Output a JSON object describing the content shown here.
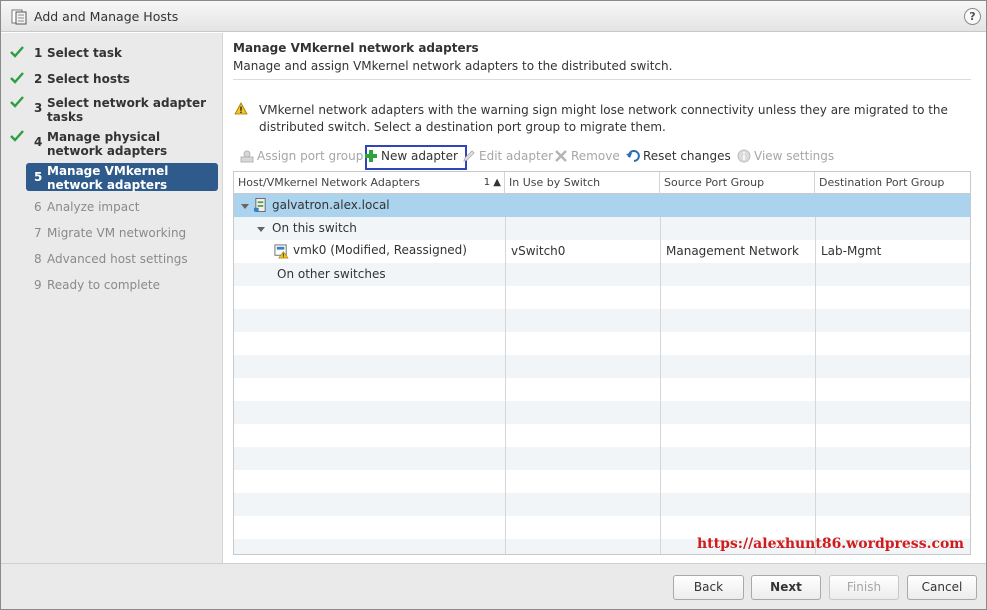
{
  "window": {
    "title": "Add and Manage Hosts",
    "help": "?"
  },
  "steps": [
    {
      "num": "1",
      "label": "Select task",
      "state": "done"
    },
    {
      "num": "2",
      "label": "Select hosts",
      "state": "done"
    },
    {
      "num": "3",
      "label": "Select network adapter tasks",
      "state": "done"
    },
    {
      "num": "4",
      "label": "Manage physical network adapters",
      "state": "done"
    },
    {
      "num": "5",
      "label": "Manage VMkernel network adapters",
      "state": "active"
    },
    {
      "num": "6",
      "label": "Analyze impact",
      "state": "future"
    },
    {
      "num": "7",
      "label": "Migrate VM networking",
      "state": "future"
    },
    {
      "num": "8",
      "label": "Advanced host settings",
      "state": "future"
    },
    {
      "num": "9",
      "label": "Ready to complete",
      "state": "future"
    }
  ],
  "main": {
    "heading": "Manage VMkernel network adapters",
    "subheading": "Manage and assign VMkernel network adapters to the distributed switch.",
    "warning": "VMkernel network adapters with the warning sign might lose network connectivity unless they are migrated to the distributed switch. Select a destination port group to migrate them."
  },
  "toolbar": {
    "assign_port_group": "Assign port group",
    "new_adapter": "New adapter",
    "edit_adapter": "Edit adapter",
    "remove": "Remove",
    "reset_changes": "Reset changes",
    "view_settings": "View settings"
  },
  "table": {
    "columns": [
      "Host/VMkernel Network Adapters",
      "In Use by Switch",
      "Source Port Group",
      "Destination Port Group"
    ],
    "sort_indicator": "1 ▲",
    "host": "galvatron.alex.local",
    "group_this": "On this switch",
    "adapter": {
      "name": "vmk0 (Modified, Reassigned)",
      "switch": "vSwitch0",
      "source": "Management Network",
      "destination": "Lab-Mgmt"
    },
    "group_other": "On other switches"
  },
  "watermark": "https://alexhunt86.wordpress.com",
  "footer": {
    "back": "Back",
    "next": "Next",
    "finish": "Finish",
    "cancel": "Cancel"
  },
  "colors": {
    "accent": "#2f5b8c",
    "selection": "#abd3ee",
    "highlight_border": "#3046b8",
    "watermark": "#d11a1a",
    "check": "#2e9e3e"
  }
}
